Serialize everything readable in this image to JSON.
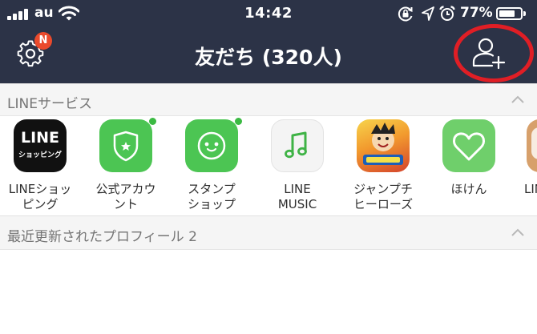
{
  "status_bar": {
    "carrier": "au",
    "time": "14:42",
    "battery_percent_text": "77%",
    "battery_level": 0.77
  },
  "nav": {
    "title": "友だち (320人)",
    "settings_badge": "N"
  },
  "sections": {
    "line_services": "LINEサービス",
    "recent_profiles": "最近更新されたプロフィール 2"
  },
  "services": [
    {
      "line1": "LINEショッ",
      "line2": "ピング",
      "icon_text": [
        "LINE",
        "ショッピング"
      ],
      "icon": "line-shopping-icon",
      "has_dot": false
    },
    {
      "line1": "公式アカウ",
      "line2": "ント",
      "icon": "shield-star-icon",
      "has_dot": true
    },
    {
      "line1": "スタンプ",
      "line2": "ショップ",
      "icon": "sticker-face-icon",
      "has_dot": true
    },
    {
      "line1": "LINE",
      "line2": "MUSIC",
      "icon": "music-note-icon",
      "has_dot": false
    },
    {
      "line1": "ジャンプチ",
      "line2": "ヒーローズ",
      "icon": "jump-heroes-icon",
      "has_dot": false
    },
    {
      "line1": "ほけん",
      "line2": "",
      "icon": "heart-icon",
      "has_dot": false
    },
    {
      "line1": "LIN",
      "line2": "",
      "icon": "partial-service-icon",
      "has_dot": false
    }
  ],
  "colors": {
    "header_bg": "#2c3347",
    "accent_green": "#3bba42",
    "highlight_red": "#e01e25",
    "badge_orange": "#ea4a2c"
  }
}
